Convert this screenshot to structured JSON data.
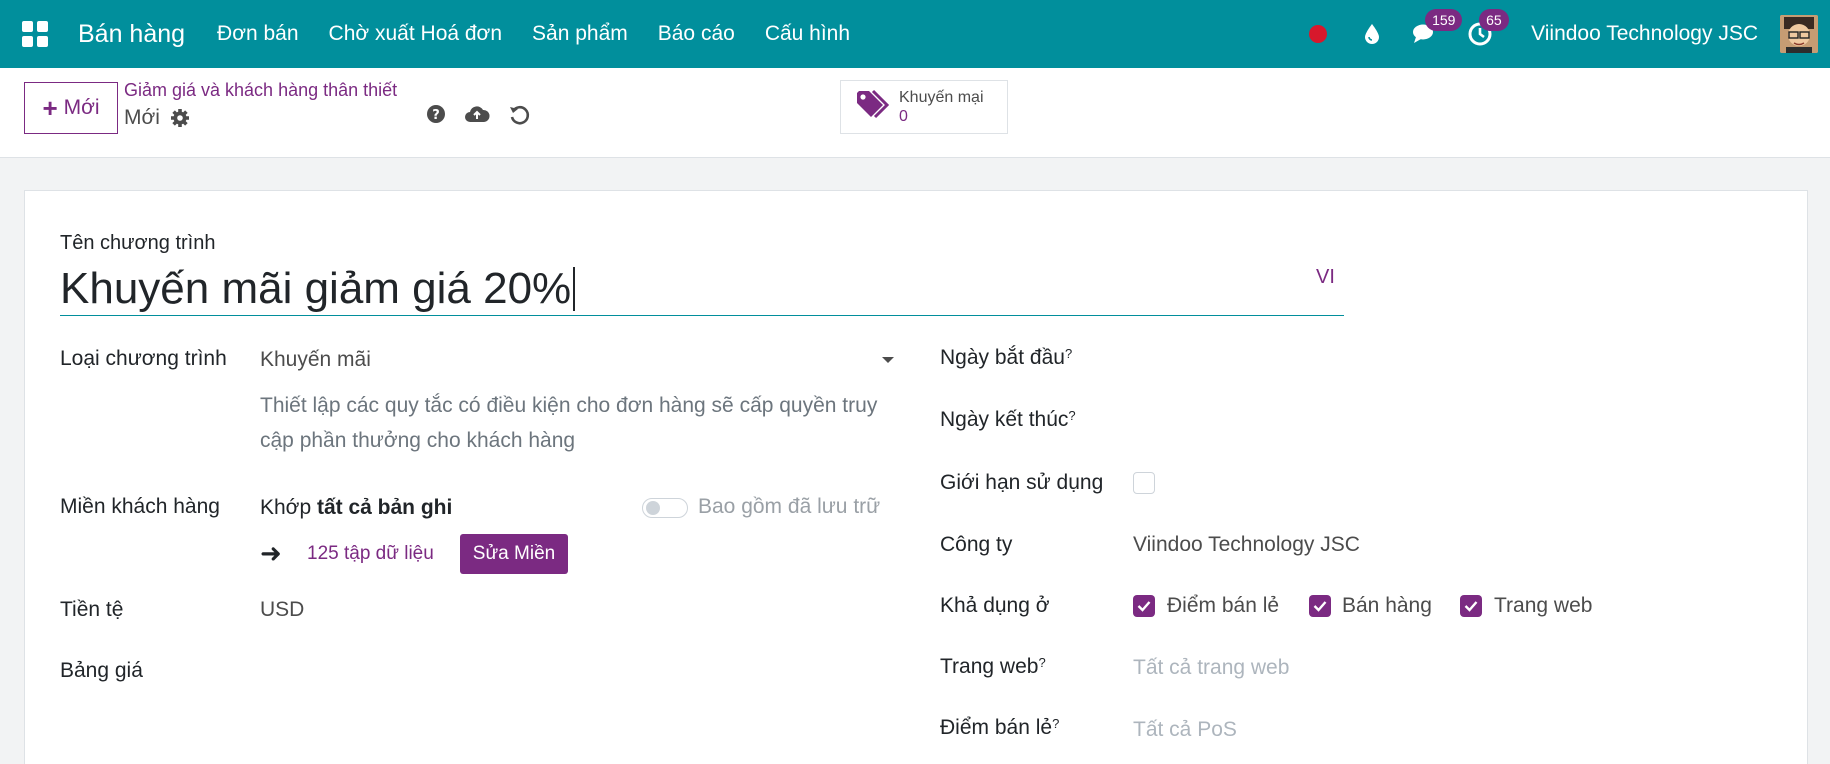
{
  "navbar": {
    "app_name": "Bán hàng",
    "menu": [
      "Đơn bán",
      "Chờ xuất Hoá đơn",
      "Sản phẩm",
      "Báo cáo",
      "Cấu hình"
    ],
    "messages_count": "159",
    "activities_count": "65",
    "company": "Viindoo Technology JSC",
    "colors": {
      "bar": "#018f9c",
      "badge": "#7b2a82",
      "record_dot": "#d7182c"
    }
  },
  "control": {
    "new_label": "Mới",
    "breadcrumb": "Giảm giá và khách hàng thân thiết",
    "record_name": "Mới",
    "smart_button": {
      "label": "Khuyến mại",
      "value": "0"
    }
  },
  "form": {
    "title_label": "Tên chương trình",
    "title_value": "Khuyến mãi giảm giá 20%",
    "lang": "VI",
    "left": {
      "program_type_label": "Loại chương trình",
      "program_type_value": "Khuyến mãi",
      "program_type_desc": "Thiết lập các quy tắc có điều kiện cho đơn hàng sẽ cấp quyền truy cập phần thưởng cho khách hàng",
      "domain_label": "Miền khách hàng",
      "domain_match": "Khớp",
      "domain_all": "tất cả bản ghi",
      "archived_label": "Bao gồm đã lưu trữ",
      "records_link": "125 tập dữ liệu",
      "edit_domain": "Sửa Miền",
      "currency_label": "Tiền tệ",
      "currency_value": "USD",
      "pricelist_label": "Bảng giá"
    },
    "right": {
      "start_label": "Ngày bắt đầu",
      "end_label": "Ngày kết thúc",
      "limit_label": "Giới hạn sử dụng",
      "company_label": "Công ty",
      "company_value": "Viindoo Technology JSC",
      "available_label": "Khả dụng ở",
      "available": [
        "Điểm bán lẻ",
        "Bán hàng",
        "Trang web"
      ],
      "website_label": "Trang web",
      "website_placeholder": "Tất cả trang web",
      "pos_label": "Điểm bán lẻ",
      "pos_placeholder": "Tất cả PoS",
      "help_mark": "?"
    }
  }
}
